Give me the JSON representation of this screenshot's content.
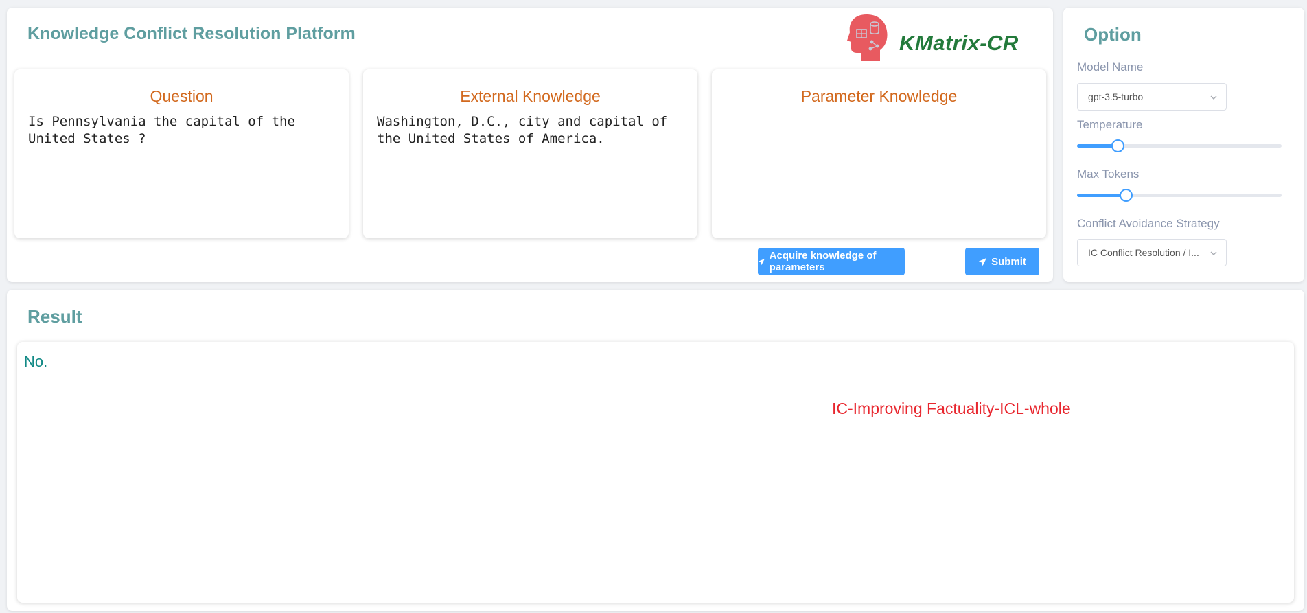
{
  "app": {
    "title": "Knowledge Conflict Resolution Platform",
    "logo_text": "KMatrix-CR"
  },
  "panels": {
    "question": {
      "title": "Question",
      "text": "Is Pennsylvania the capital of the\nUnited States ?"
    },
    "external": {
      "title": "External Knowledge",
      "text": "Washington, D.C., city and capital of\nthe United States of America."
    },
    "parameter": {
      "title": "Parameter Knowledge",
      "text": ""
    }
  },
  "actions": {
    "acquire_label": "Acquire knowledge of parameters",
    "submit_label": "Submit"
  },
  "options": {
    "title": "Option",
    "model_name": {
      "label": "Model Name",
      "value": "gpt-3.5-turbo"
    },
    "temperature": {
      "label": "Temperature",
      "level": 0.2
    },
    "max_tokens": {
      "label": "Max Tokens",
      "level": 0.24
    },
    "strategy": {
      "label": "Conflict Avoidance Strategy",
      "value": "IC Conflict Resolution / I..."
    }
  },
  "result": {
    "title": "Result",
    "answer": "No.",
    "strategy_tag": "IC-Improving Factuality-ICL-whole"
  },
  "colors": {
    "accent": "#409eff",
    "title": "#5f9ea0",
    "panel_title": "#d2691e",
    "answer": "#138a86",
    "strategy": "#e8262e",
    "logo_green": "#237a3b",
    "logo_red": "#e85a60"
  }
}
